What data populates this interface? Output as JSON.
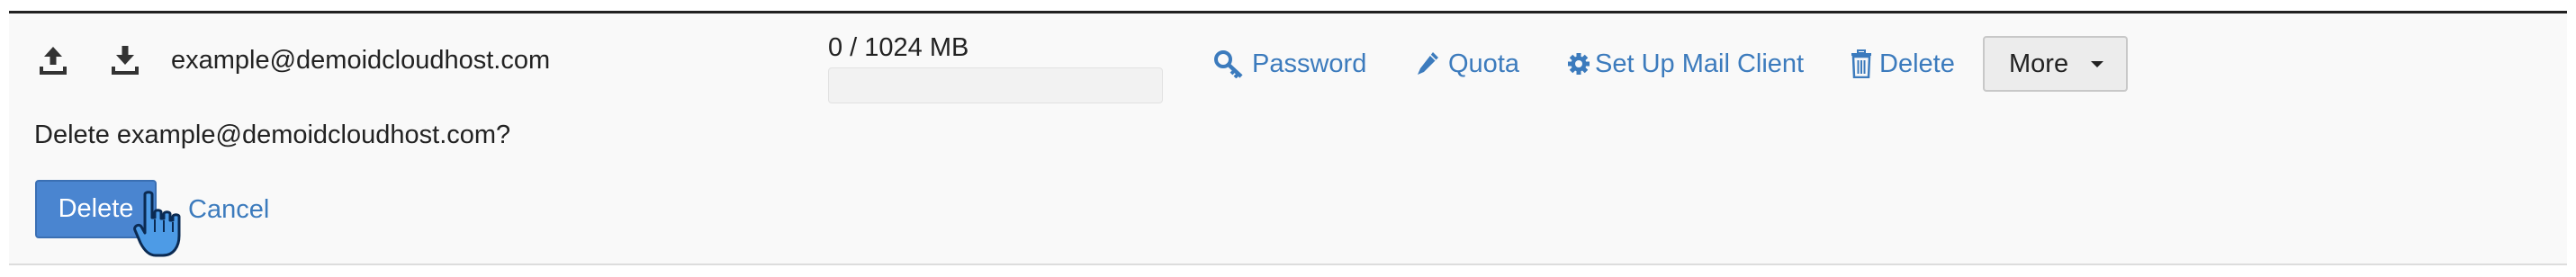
{
  "email_row": {
    "account": "example@demoidcloudhost.com",
    "usage": {
      "text": "0 / 1024 MB",
      "fraction_used": 0
    },
    "actions": {
      "password": "Password",
      "quota": "Quota",
      "setup_mail_client": "Set Up Mail Client",
      "delete": "Delete",
      "more": "More"
    },
    "icons": {
      "upload": "upload-icon",
      "download": "download-icon",
      "password": "key-icon",
      "quota": "pencil-icon",
      "setup_mail_client": "gear-icon",
      "delete": "trash-icon",
      "more": "caret-down-icon",
      "pointer": "hand-pointer-cursor"
    }
  },
  "delete_confirmation": {
    "prompt": "Delete example@demoidcloudhost.com?",
    "delete_label": "Delete",
    "cancel_label": "Cancel"
  },
  "colors": {
    "link": "#3c7bbd",
    "primary_button": "#4a85d0",
    "row_background": "#f9f9f9"
  }
}
